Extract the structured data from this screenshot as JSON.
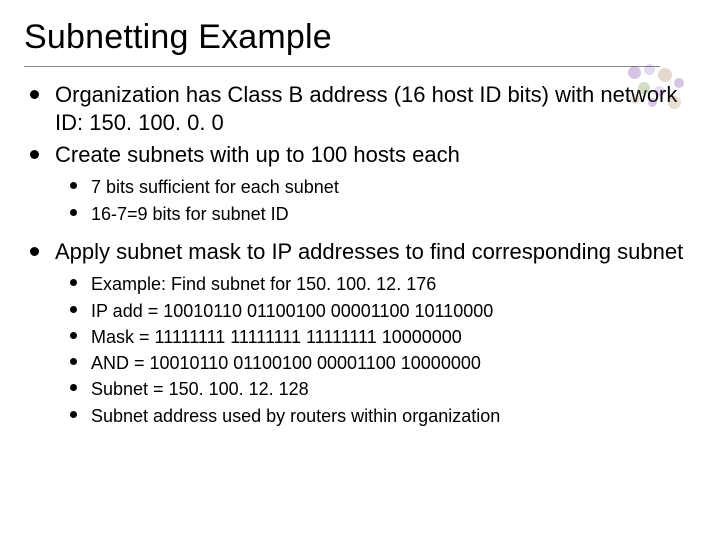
{
  "title": "Subnetting Example",
  "bullets": {
    "b1": "Organization has Class B address (16 host ID bits) with network ID: 150. 100. 0. 0",
    "b2": "Create subnets with up to 100 hosts each",
    "b2_sub": {
      "s1": "7 bits sufficient for each subnet",
      "s2": "16-7=9 bits for subnet ID"
    },
    "b3": "Apply subnet mask to IP addresses to find corresponding subnet",
    "b3_sub": {
      "s1": "Example:  Find subnet for 150. 100. 12. 176",
      "s2": "IP add = 10010110 01100100 00001100 10110000",
      "s3": "Mask   = 11111111 11111111 11111111 10000000",
      "s4": "AND    = 10010110 01100100 00001100 10000000",
      "s5": "Subnet = 150. 100. 12. 128",
      "s6": "Subnet address used by routers within organization"
    }
  }
}
